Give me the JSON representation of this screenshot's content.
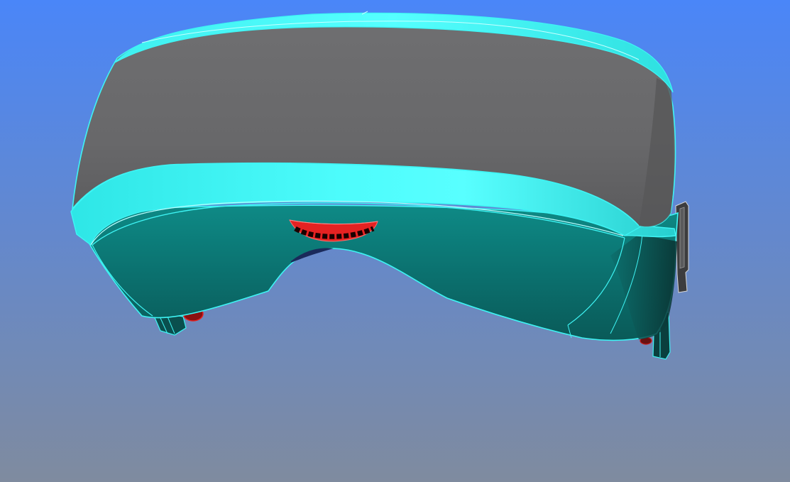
{
  "viewport": {
    "background_top": "#4a86f8",
    "background_bottom": "#7f8b9f"
  },
  "model": {
    "name": "vr-headset",
    "edge_color": "#3ef4f4",
    "strap_color": "#6a6a6c",
    "shell_color": "#0e7a78",
    "rim_color": "#49fafa",
    "accent_color": "#e52222",
    "bracket_color": "#4a4a4a"
  }
}
